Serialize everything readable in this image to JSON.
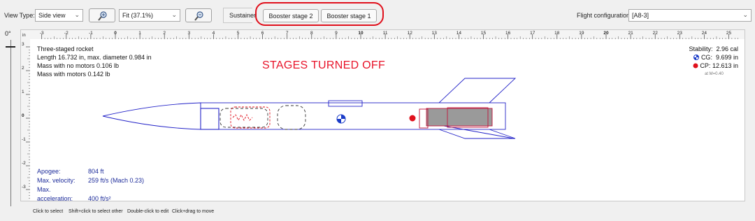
{
  "toolbar": {
    "view_type_label": "View Type:",
    "view_type_value": "Side view",
    "zoom_value": "Fit (37.1%)",
    "sustainer_label": "Sustainer",
    "booster2_label": "Booster stage 2",
    "booster1_label": "Booster stage 1",
    "flight_config_label": "Flight configuration:",
    "flight_config_value": "[A8-3]",
    "highlight_color": "#e0101c"
  },
  "rotation": {
    "label": "0°"
  },
  "ruler": {
    "unit": "in",
    "h_labels": [
      "-3",
      "-2",
      "-1",
      "0",
      "1",
      "2",
      "3",
      "4",
      "5",
      "6",
      "7",
      "8",
      "9",
      "10",
      "11",
      "12",
      "13",
      "14",
      "15",
      "16",
      "17",
      "18",
      "19",
      "20",
      "21",
      "22",
      "23",
      "24",
      "25"
    ],
    "v_labels": [
      "3",
      "2",
      "1",
      "0",
      "-1",
      "-2",
      "-3"
    ]
  },
  "annotation": {
    "text": "STAGES TURNED OFF",
    "color": "#e8142a"
  },
  "rocket_info": {
    "name": "Three-staged rocket",
    "dims": "Length 16.732 in, max. diameter 0.984 in",
    "mass_no_motors": "Mass with no motors 0.106 lb",
    "mass_with_motors": "Mass with motors 0.142 lb"
  },
  "stability": {
    "label": "Stability:",
    "value": "2.96 cal",
    "cg_label": "CG:",
    "cg_value": "9.699 in",
    "cp_label": "CP:",
    "cp_value": "12.613 in",
    "mach_note": "at M=0.40"
  },
  "flight": {
    "apogee_label": "Apogee:",
    "apogee_value": "804 ft",
    "velocity_label": "Max. velocity:",
    "velocity_value": "259 ft/s  (Mach 0.23)",
    "accel_label": "Max. acceleration:",
    "accel_value": "400 ft/s²"
  },
  "status": {
    "hint1": "Click to select",
    "hint2": "Shift+click to select other",
    "hint3": "Double-click to edit",
    "hint4": "Click+drag to move"
  },
  "colors": {
    "rocket_outline": "#2323c8",
    "motor_fill": "#9a9a9a",
    "motor_outline": "#c0143c",
    "cp_color": "#e0101c",
    "cg_color": "#1a3cc8",
    "flight_text": "#1c2b9a"
  }
}
